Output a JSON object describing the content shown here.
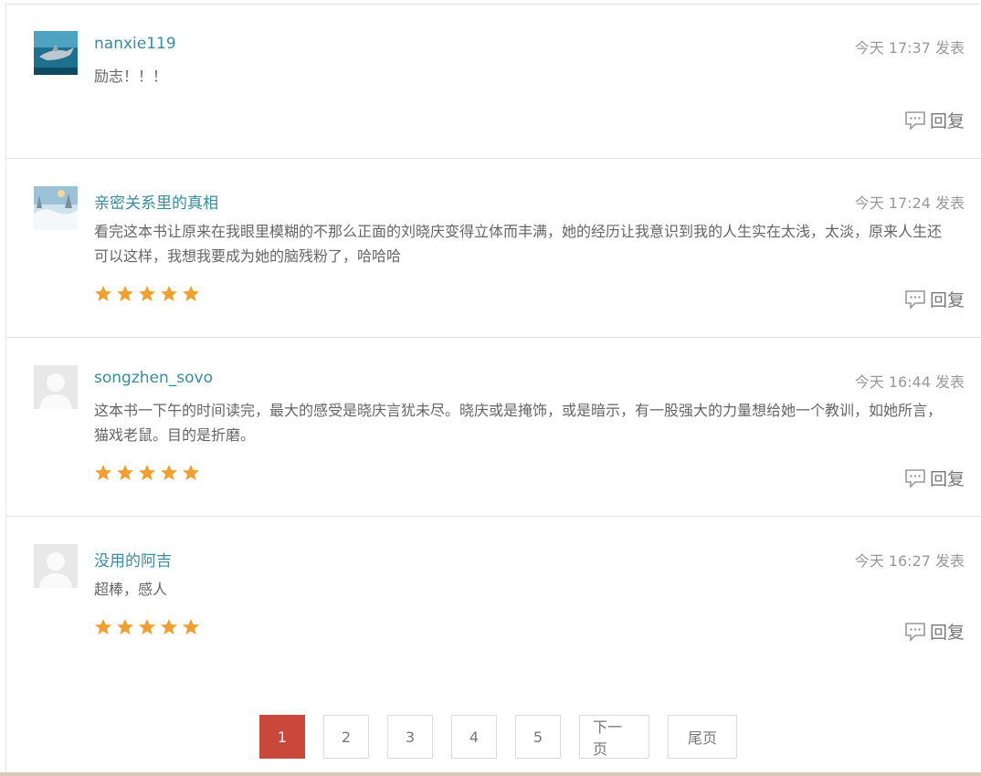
{
  "comments": [
    {
      "username": "nanxie119",
      "time": "今天 17:37 发表",
      "text": "励志！！！",
      "avatar": "shark-avatar",
      "rating": 0,
      "reply_label": "回复"
    },
    {
      "username": "亲密关系里的真相",
      "time": "今天 17:24 发表",
      "text": "看完这本书让原来在我眼里模糊的不那么正面的刘晓庆变得立体而丰满，她的经历让我意识到我的人生实在太浅，太淡，原来人生还可以这样，我想我要成为她的脑残粉了，哈哈哈",
      "avatar": "snow-landscape-avatar",
      "rating": 5,
      "reply_label": "回复"
    },
    {
      "username": "songzhen_sovo",
      "time": "今天 16:44 发表",
      "text": "这本书一下午的时间读完，最大的感受是晓庆言犹未尽。晓庆或是掩饰，或是暗示，有一股强大的力量想给她一个教训，如她所言，猫戏老鼠。目的是折磨。",
      "avatar": "default-avatar",
      "rating": 5,
      "reply_label": "回复"
    },
    {
      "username": "没用的阿吉",
      "time": "今天 16:27 发表",
      "text": "超棒，感人",
      "avatar": "default-avatar",
      "rating": 5,
      "reply_label": "回复"
    }
  ],
  "pagination": {
    "pages": [
      "1",
      "2",
      "3",
      "4",
      "5"
    ],
    "active": "1",
    "next_label": "下一页",
    "last_label": "尾页"
  },
  "colors": {
    "username": "#3a8c9e",
    "star": "#f0a030",
    "active_page": "#c9473b"
  }
}
